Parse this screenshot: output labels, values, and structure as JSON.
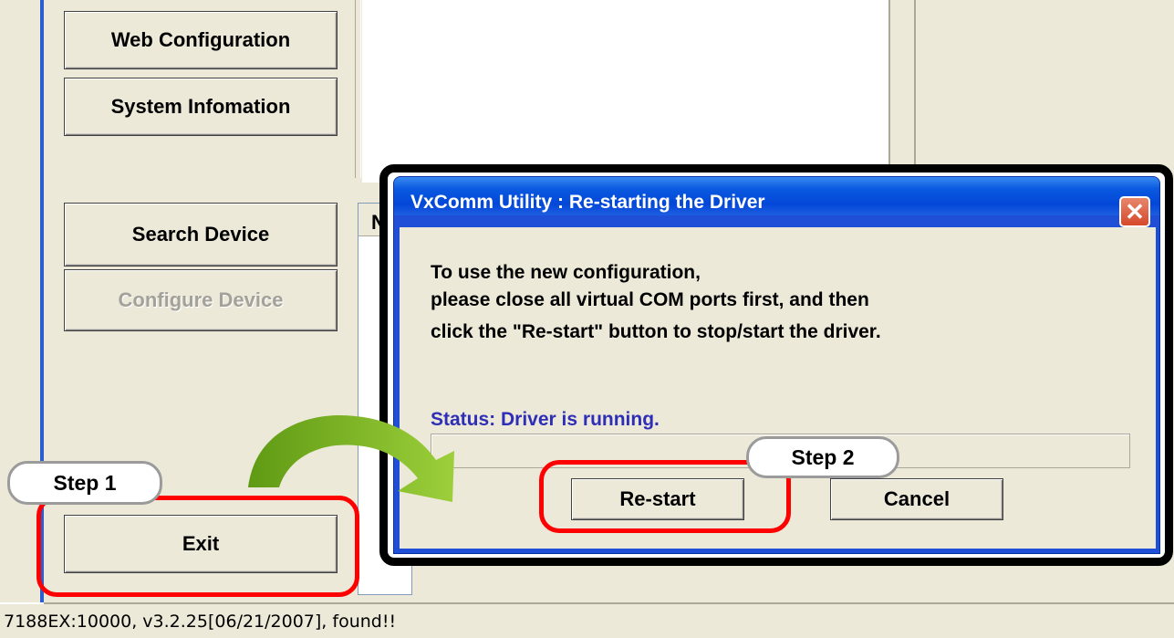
{
  "app": {
    "buttons": {
      "web_config": "Web Configuration",
      "system_info": "System Infomation",
      "search_device": "Search Device",
      "configure_device": "Configure Device",
      "exit": "Exit"
    },
    "list_header_fragment": "N",
    "status_bar": "7188EX:10000, v3.2.25[06/21/2007], found!!"
  },
  "dialog": {
    "title": "VxComm Utility : Re-starting the Driver",
    "close_glyph": "✕",
    "message_lines": [
      "To use the new configuration,",
      "please close all virtual COM ports first, and then",
      "click the \"Re-start\" button to stop/start the driver."
    ],
    "status": "Status: Driver is running.",
    "restart_label": "Re-start",
    "cancel_label": "Cancel"
  },
  "annotations": {
    "step1": "Step 1",
    "step2": "Step 2"
  },
  "colors": {
    "highlight_ring": "#ff0000",
    "arrow": "#7aac1e",
    "xp_face": "#ece9d8",
    "titlebar_blue": "#0a5ae0",
    "status_blue": "#2e2eb8"
  }
}
